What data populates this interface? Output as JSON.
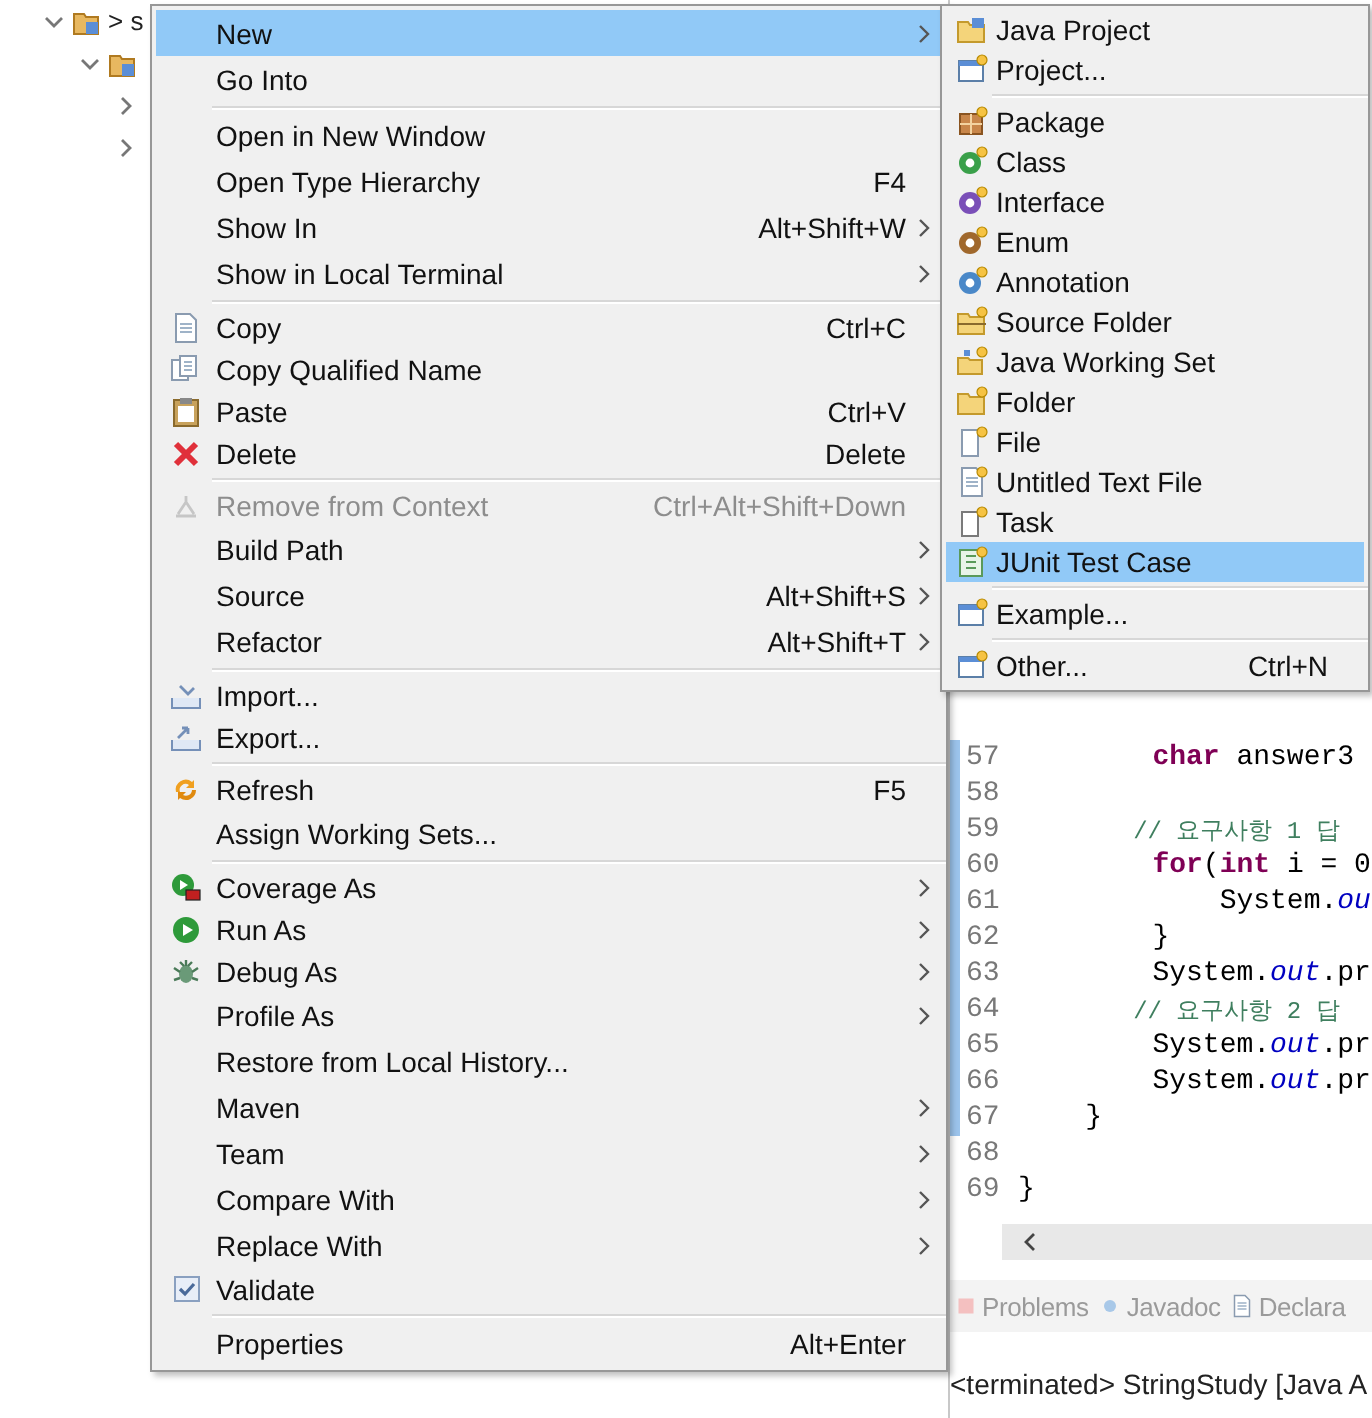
{
  "explorer": {
    "tree": [
      {
        "label": "> s",
        "expanded": true,
        "children": [
          {
            "expanded": true,
            "children": [
              {
                "expanded": false
              },
              {
                "expanded": false
              }
            ]
          }
        ]
      }
    ]
  },
  "context_menu": {
    "items": [
      {
        "kind": "item",
        "label": "New",
        "submenu": true,
        "selected": true,
        "disabled": false,
        "checked": false
      },
      {
        "kind": "item",
        "label": "Go Into",
        "submenu": false,
        "selected": false,
        "disabled": false,
        "checked": false
      },
      {
        "kind": "separator"
      },
      {
        "kind": "item",
        "label": "Open in New Window",
        "submenu": false,
        "selected": false,
        "disabled": false,
        "checked": false
      },
      {
        "kind": "item",
        "label": "Open Type Hierarchy",
        "shortcut": "F4",
        "submenu": false,
        "selected": false,
        "disabled": false,
        "checked": false
      },
      {
        "kind": "item",
        "label": "Show In",
        "shortcut": "Alt+Shift+W",
        "submenu": true,
        "selected": false,
        "disabled": false,
        "checked": false
      },
      {
        "kind": "item",
        "label": "Show in Local Terminal",
        "submenu": true,
        "selected": false,
        "disabled": false,
        "checked": false
      },
      {
        "kind": "separator"
      },
      {
        "kind": "item",
        "label": "Copy",
        "shortcut": "Ctrl+C",
        "submenu": false,
        "selected": false,
        "disabled": false,
        "checked": false
      },
      {
        "kind": "item",
        "label": "Copy Qualified Name",
        "submenu": false,
        "selected": false,
        "disabled": false,
        "checked": false
      },
      {
        "kind": "item",
        "label": "Paste",
        "shortcut": "Ctrl+V",
        "submenu": false,
        "selected": false,
        "disabled": false,
        "checked": false
      },
      {
        "kind": "item",
        "label": "Delete",
        "shortcut": "Delete",
        "submenu": false,
        "selected": false,
        "disabled": false,
        "checked": false
      },
      {
        "kind": "separator"
      },
      {
        "kind": "item",
        "label": "Remove from Context",
        "shortcut": "Ctrl+Alt+Shift+Down",
        "submenu": false,
        "selected": false,
        "disabled": true,
        "checked": false
      },
      {
        "kind": "item",
        "label": "Build Path",
        "submenu": true,
        "selected": false,
        "disabled": false,
        "checked": false
      },
      {
        "kind": "item",
        "label": "Source",
        "shortcut": "Alt+Shift+S",
        "submenu": true,
        "selected": false,
        "disabled": false,
        "checked": false
      },
      {
        "kind": "item",
        "label": "Refactor",
        "shortcut": "Alt+Shift+T",
        "submenu": true,
        "selected": false,
        "disabled": false,
        "checked": false
      },
      {
        "kind": "separator"
      },
      {
        "kind": "item",
        "label": "Import...",
        "submenu": false,
        "selected": false,
        "disabled": false,
        "checked": false
      },
      {
        "kind": "item",
        "label": "Export...",
        "submenu": false,
        "selected": false,
        "disabled": false,
        "checked": false
      },
      {
        "kind": "separator"
      },
      {
        "kind": "item",
        "label": "Refresh",
        "shortcut": "F5",
        "submenu": false,
        "selected": false,
        "disabled": false,
        "checked": false
      },
      {
        "kind": "item",
        "label": "Assign Working Sets...",
        "submenu": false,
        "selected": false,
        "disabled": false,
        "checked": false
      },
      {
        "kind": "separator"
      },
      {
        "kind": "item",
        "label": "Coverage As",
        "submenu": true,
        "selected": false,
        "disabled": false,
        "checked": false
      },
      {
        "kind": "item",
        "label": "Run As",
        "submenu": true,
        "selected": false,
        "disabled": false,
        "checked": false
      },
      {
        "kind": "item",
        "label": "Debug As",
        "submenu": true,
        "selected": false,
        "disabled": false,
        "checked": false
      },
      {
        "kind": "item",
        "label": "Profile As",
        "submenu": true,
        "selected": false,
        "disabled": false,
        "checked": false
      },
      {
        "kind": "item",
        "label": "Restore from Local History...",
        "submenu": false,
        "selected": false,
        "disabled": false,
        "checked": false
      },
      {
        "kind": "item",
        "label": "Maven",
        "submenu": true,
        "selected": false,
        "disabled": false,
        "checked": false
      },
      {
        "kind": "item",
        "label": "Team",
        "submenu": true,
        "selected": false,
        "disabled": false,
        "checked": false
      },
      {
        "kind": "item",
        "label": "Compare With",
        "submenu": true,
        "selected": false,
        "disabled": false,
        "checked": false
      },
      {
        "kind": "item",
        "label": "Replace With",
        "submenu": true,
        "selected": false,
        "disabled": false,
        "checked": false
      },
      {
        "kind": "item",
        "label": "Validate",
        "submenu": false,
        "selected": false,
        "disabled": false,
        "checked": true
      },
      {
        "kind": "separator"
      },
      {
        "kind": "item",
        "label": "Properties",
        "shortcut": "Alt+Enter",
        "submenu": false,
        "selected": false,
        "disabled": false,
        "checked": false
      }
    ]
  },
  "new_submenu": {
    "items": [
      {
        "kind": "item",
        "label": "Java Project",
        "selected": false
      },
      {
        "kind": "item",
        "label": "Project...",
        "selected": false
      },
      {
        "kind": "separator"
      },
      {
        "kind": "item",
        "label": "Package",
        "selected": false
      },
      {
        "kind": "item",
        "label": "Class",
        "selected": false
      },
      {
        "kind": "item",
        "label": "Interface",
        "selected": false
      },
      {
        "kind": "item",
        "label": "Enum",
        "selected": false
      },
      {
        "kind": "item",
        "label": "Annotation",
        "selected": false
      },
      {
        "kind": "item",
        "label": "Source Folder",
        "selected": false
      },
      {
        "kind": "item",
        "label": "Java Working Set",
        "selected": false
      },
      {
        "kind": "item",
        "label": "Folder",
        "selected": false
      },
      {
        "kind": "item",
        "label": "File",
        "selected": false
      },
      {
        "kind": "item",
        "label": "Untitled Text File",
        "selected": false
      },
      {
        "kind": "item",
        "label": "Task",
        "selected": false
      },
      {
        "kind": "item",
        "label": "JUnit Test Case",
        "selected": true
      },
      {
        "kind": "separator"
      },
      {
        "kind": "item",
        "label": "Example...",
        "selected": false
      },
      {
        "kind": "separator"
      },
      {
        "kind": "item",
        "label": "Other...",
        "shortcut": "Ctrl+N",
        "selected": false
      }
    ]
  },
  "editor": {
    "lines": [
      {
        "number": "57",
        "tokens": [
          {
            "kind": "keyword",
            "text": "        char"
          },
          {
            "kind": "plain",
            "text": " answer3"
          }
        ]
      },
      {
        "number": "58"
      },
      {
        "number": "59",
        "tokens": [
          {
            "kind": "comment",
            "text": "        // 요구사항 1 답"
          }
        ]
      },
      {
        "number": "60",
        "tokens": [
          {
            "kind": "keyword",
            "text": "        for"
          },
          {
            "kind": "plain",
            "text": "("
          },
          {
            "kind": "keyword",
            "text": "int"
          },
          {
            "kind": "plain",
            "text": " i = 0"
          }
        ]
      },
      {
        "number": "61",
        "tokens": [
          {
            "kind": "plain",
            "text": "            System."
          },
          {
            "kind": "field",
            "text": "ou"
          }
        ]
      },
      {
        "number": "62",
        "tokens": [
          {
            "kind": "plain",
            "text": "        }"
          }
        ]
      },
      {
        "number": "63",
        "tokens": [
          {
            "kind": "plain",
            "text": "        System."
          },
          {
            "kind": "field",
            "text": "out"
          },
          {
            "kind": "plain",
            "text": ".pr"
          }
        ]
      },
      {
        "number": "64",
        "tokens": [
          {
            "kind": "comment",
            "text": "        // 요구사항 2 답"
          }
        ]
      },
      {
        "number": "65",
        "tokens": [
          {
            "kind": "plain",
            "text": "        System."
          },
          {
            "kind": "field",
            "text": "out"
          },
          {
            "kind": "plain",
            "text": ".pr"
          }
        ]
      },
      {
        "number": "66",
        "tokens": [
          {
            "kind": "plain",
            "text": "        System."
          },
          {
            "kind": "field",
            "text": "out"
          },
          {
            "kind": "plain",
            "text": ".pr"
          }
        ]
      },
      {
        "number": "67",
        "tokens": [
          {
            "kind": "plain",
            "text": "    }"
          }
        ]
      },
      {
        "number": "68"
      },
      {
        "number": "69",
        "tokens": [
          {
            "kind": "plain",
            "text": "}"
          }
        ]
      }
    ]
  },
  "bottom_tabs": [
    {
      "label": "Problems"
    },
    {
      "label": "Javadoc"
    },
    {
      "label": "Declara"
    }
  ],
  "console": {
    "text": "<terminated> StringStudy [Java A"
  }
}
